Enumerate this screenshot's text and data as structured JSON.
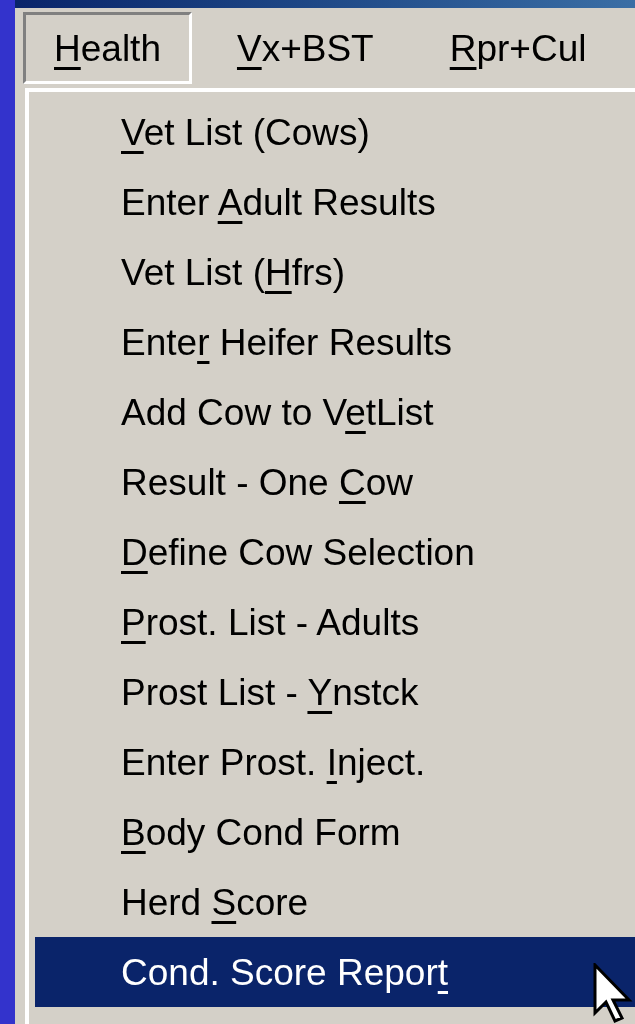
{
  "menu_bar": [
    {
      "key": "H",
      "post": "ealth",
      "selected": true
    },
    {
      "key": "V",
      "post": "x+BST",
      "selected": false
    },
    {
      "key": "R",
      "post": "pr+Cul",
      "selected": false
    }
  ],
  "menu": [
    {
      "key": "V",
      "post": "et List (Cows)",
      "selected": false
    },
    {
      "pre": "Enter ",
      "key": "A",
      "post": "dult Results",
      "selected": false
    },
    {
      "pre": "Vet List (",
      "key": "H",
      "post": "frs)",
      "selected": false
    },
    {
      "pre": "Ente",
      "key": "r",
      "post": " Heifer Results",
      "selected": false
    },
    {
      "pre": "Add Cow to V",
      "key": "e",
      "post": "tList",
      "selected": false
    },
    {
      "pre": "Result - One ",
      "key": "C",
      "post": "ow",
      "selected": false
    },
    {
      "key": "D",
      "post": "efine Cow Selection",
      "selected": false
    },
    {
      "key": "P",
      "post": "rost. List - Adults",
      "selected": false
    },
    {
      "pre": "Prost List - ",
      "key": "Y",
      "post": "nstck",
      "selected": false
    },
    {
      "pre": "Enter Prost. ",
      "key": "I",
      "post": "nject.",
      "selected": false
    },
    {
      "key": "B",
      "post": "ody Cond Form",
      "selected": false
    },
    {
      "pre": "Herd ",
      "key": "S",
      "post": "core",
      "selected": false
    },
    {
      "pre": "Cond. Score Repor",
      "key": "t",
      "selected": true
    }
  ]
}
